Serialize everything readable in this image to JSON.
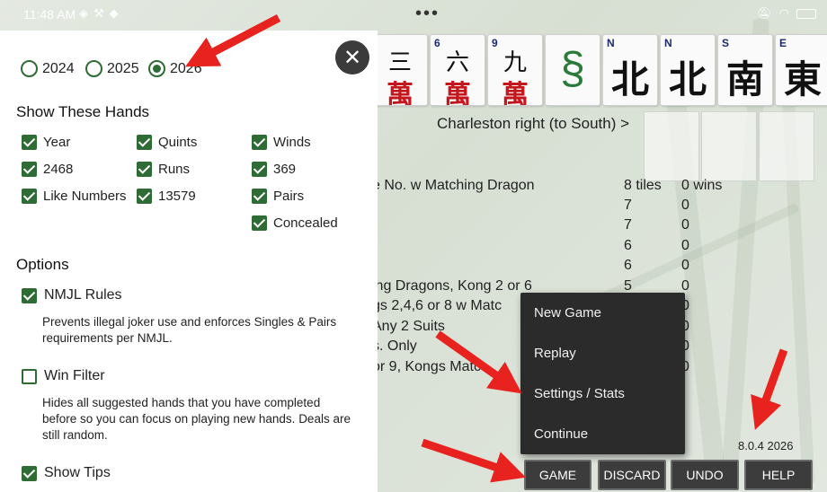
{
  "status_bar": {
    "time": "11:48 AM",
    "left_icons": [
      "drive-icon",
      "wrench-icon",
      "tag-icon"
    ],
    "overflow": "•••",
    "right_icons": [
      "bell-off-icon",
      "wifi-icon",
      "battery-icon"
    ]
  },
  "tiles": [
    {
      "corner": "",
      "top": "三",
      "bottom": "萬"
    },
    {
      "corner": "6",
      "top": "六",
      "bottom": "萬"
    },
    {
      "corner": "9",
      "top": "九",
      "bottom": "萬"
    },
    {
      "corner": "",
      "dragon": true
    },
    {
      "corner": "N",
      "wind": "北"
    },
    {
      "corner": "N",
      "wind": "北"
    },
    {
      "corner": "S",
      "wind": "南"
    },
    {
      "corner": "E",
      "wind": "東"
    }
  ],
  "charleston": "Charleston right (to South) >",
  "hands": [
    {
      "name": "e No. w Matching Dragon",
      "tiles": "8 tiles",
      "wins": "0 wins"
    },
    {
      "name": "",
      "tiles": "7",
      "wins": "0"
    },
    {
      "name": "",
      "tiles": "7",
      "wins": "0"
    },
    {
      "name": "",
      "tiles": "6",
      "wins": "0"
    },
    {
      "name": "",
      "tiles": "6",
      "wins": "0"
    },
    {
      "name": "ing Dragons, Kong 2 or 6",
      "tiles": "5",
      "wins": "0"
    },
    {
      "name": "gs 2,4,6 or 8 w Matc",
      "tiles": "",
      "wins": "0"
    },
    {
      "name": " Any 2 Suits",
      "tiles": "",
      "wins": "0"
    },
    {
      "name": "s. Only",
      "tiles": "",
      "wins": "0"
    },
    {
      "name": "or 9, Kongs Matc",
      "tiles": "",
      "wins": "0"
    }
  ],
  "menu": {
    "items": [
      "New Game",
      "Replay",
      "Settings / Stats",
      "Continue"
    ]
  },
  "version": "8.0.4 2026",
  "buttons": {
    "game": "GAME",
    "discard": "DISCARD",
    "undo": "UNDO",
    "help": "HELP"
  },
  "panel": {
    "close": "✕",
    "years": [
      {
        "label": "2024",
        "selected": false
      },
      {
        "label": "2025",
        "selected": false
      },
      {
        "label": "2026",
        "selected": true
      }
    ],
    "show_hands_title": "Show These Hands",
    "hand_filters": [
      {
        "label": "Year",
        "checked": true
      },
      {
        "label": "Quints",
        "checked": true
      },
      {
        "label": "Winds",
        "checked": true
      },
      {
        "label": "2468",
        "checked": true
      },
      {
        "label": "Runs",
        "checked": true
      },
      {
        "label": "369",
        "checked": true
      },
      {
        "label": "Like Numbers",
        "checked": true
      },
      {
        "label": "13579",
        "checked": true
      },
      {
        "label": "Pairs",
        "checked": true
      },
      {
        "label": "Concealed",
        "checked": true
      }
    ],
    "options_title": "Options",
    "options": [
      {
        "label": "NMJL Rules",
        "checked": true,
        "desc": "Prevents illegal joker use and enforces Singles & Pairs requirements per NMJL."
      },
      {
        "label": "Win Filter",
        "checked": false,
        "desc": "Hides all suggested hands that you have completed before so you can focus on playing new hands. Deals are still random."
      },
      {
        "label": "Show Tips",
        "checked": true,
        "desc": ""
      }
    ]
  },
  "colors": {
    "accent_green": "#2f6b34",
    "arrow_red": "#e8231f",
    "menu_bg": "#2b2b2b",
    "button_bg": "#3c3c3c"
  }
}
